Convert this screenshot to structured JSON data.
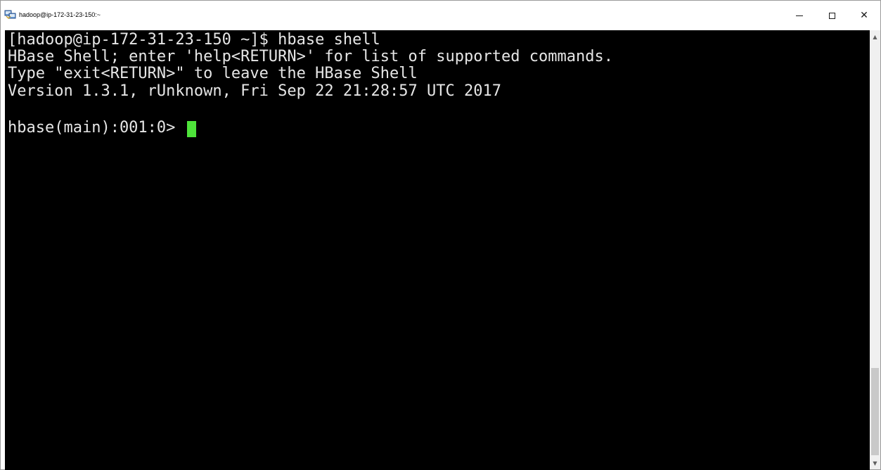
{
  "window": {
    "title": "hadoop@ip-172-31-23-150:~",
    "icon": "putty-icon",
    "controls": {
      "minimize_icon": "minimize-icon",
      "maximize_icon": "maximize-icon",
      "close_label": "✕"
    }
  },
  "terminal": {
    "lines": [
      "[hadoop@ip-172-31-23-150 ~]$ hbase shell",
      "HBase Shell; enter 'help<RETURN>' for list of supported commands.",
      "Type \"exit<RETURN>\" to leave the HBase Shell",
      "Version 1.3.1, rUnknown, Fri Sep 22 21:28:57 UTC 2017"
    ],
    "prompt": "hbase(main):001:0> ",
    "colors": {
      "background": "#000000",
      "foreground": "#e6e6e6",
      "cursor": "#4ee33a"
    }
  },
  "scrollbar": {
    "up_arrow": "▲",
    "down_arrow": "▼"
  }
}
